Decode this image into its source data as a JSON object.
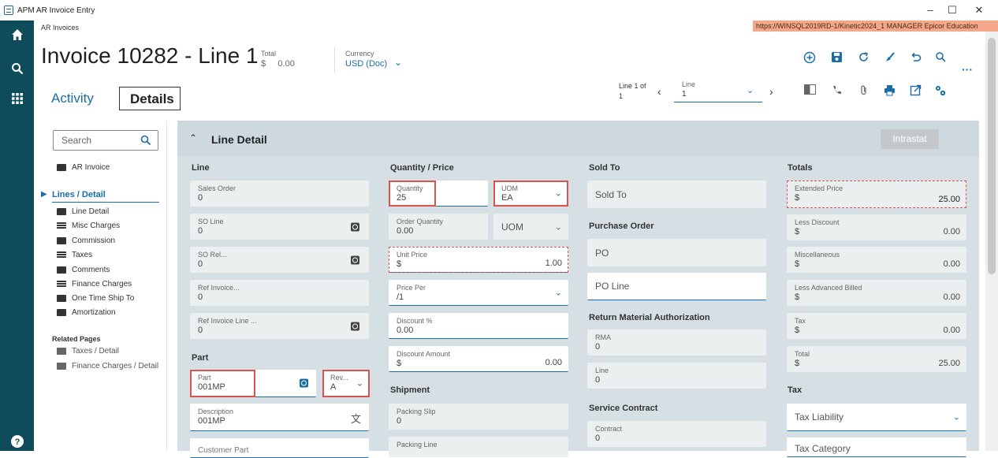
{
  "window": {
    "title": "APM AR Invoice Entry",
    "min": "–",
    "max": "☐",
    "close": "✕"
  },
  "breadcrumb": "AR Invoices",
  "infobar": "https://WINSQL2019RD-1/Kinetic2024_1   MANAGER   Epicor Education",
  "header": {
    "title": "Invoice 10282 - Line 1",
    "total_label": "Total",
    "total_value": "$     0.00",
    "currency_label": "Currency",
    "currency_value": "USD (Doc)"
  },
  "tabs": {
    "activity": "Activity",
    "details": "Details"
  },
  "linenav": {
    "line_of": "Line 1 of",
    "line_count": "1",
    "line_label": "Line",
    "line_value": "1"
  },
  "nav": {
    "search_placeholder": "Search",
    "ar_invoice": "AR Invoice",
    "lines_detail": "Lines / Detail",
    "items": [
      "Line Detail",
      "Misc Charges",
      "Commission",
      "Taxes",
      "Comments",
      "Finance Charges",
      "One Time Ship To",
      "Amortization"
    ],
    "related_pages": "Related Pages",
    "related": [
      "Taxes / Detail",
      "Finance Charges / Detail"
    ]
  },
  "section": {
    "title": "Line Detail",
    "intrastat": "Intrastat"
  },
  "line": {
    "heading": "Line",
    "sales_order_label": "Sales Order",
    "sales_order": "0",
    "so_line_label": "SO Line",
    "so_line": "0",
    "so_rel_label": "SO Rel...",
    "so_rel": "0",
    "ref_invoice_label": "Ref Invoice...",
    "ref_invoice": "0",
    "ref_invoice_line_label": "Ref Invoice Line ...",
    "ref_invoice_line": "0"
  },
  "part": {
    "heading": "Part",
    "part_label": "Part",
    "part": "001MP",
    "rev_label": "Rev...",
    "rev": "A",
    "description_label": "Description",
    "description": "001MP",
    "customer_part": "Customer Part"
  },
  "qty": {
    "heading": "Quantity / Price",
    "quantity_label": "Quantity",
    "quantity": "25",
    "uom_label": "UOM",
    "uom": "EA",
    "order_qty_label": "Order Quantity",
    "order_qty": "0.00",
    "uom2": "UOM",
    "unit_price_label": "Unit Price",
    "unit_price_cur": "$",
    "unit_price": "1.00",
    "price_per_label": "Price Per",
    "price_per": "/1",
    "discount_pct_label": "Discount %",
    "discount_pct": "0.00",
    "discount_amt_label": "Discount Amount",
    "discount_amt_cur": "$",
    "discount_amt": "0.00"
  },
  "shipment": {
    "heading": "Shipment",
    "packing_slip_label": "Packing Slip",
    "packing_slip": "0",
    "packing_line_label": "Packing Line"
  },
  "soldto": {
    "heading": "Sold To",
    "sold_to": "Sold To",
    "po_heading": "Purchase Order",
    "po": "PO",
    "po_line": "PO Line",
    "rma_heading": "Return Material Authorization",
    "rma_label": "RMA",
    "rma": "0",
    "line_label": "Line",
    "line": "0",
    "sc_heading": "Service Contract",
    "contract_label": "Contract",
    "contract": "0"
  },
  "totals": {
    "heading": "Totals",
    "ext_price_label": "Extended Price",
    "ext_price": "25.00",
    "less_discount_label": "Less Discount",
    "less_discount": "0.00",
    "misc_label": "Miscellaneous",
    "misc": "0.00",
    "less_adv_label": "Less Advanced Billed",
    "less_adv": "0.00",
    "tax_label": "Tax",
    "tax": "0.00",
    "total_label": "Total",
    "total": "25.00",
    "currency_symbol": "$",
    "tax_heading": "Tax",
    "tax_liability": "Tax Liability",
    "tax_category": "Tax Category"
  }
}
